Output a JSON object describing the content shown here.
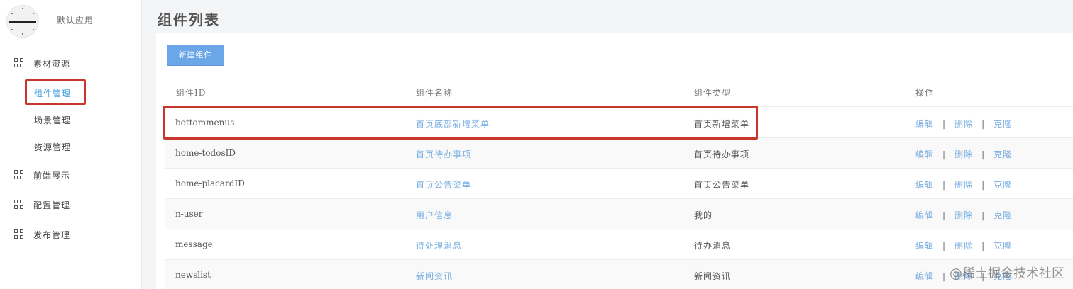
{
  "app": {
    "name": "默认应用"
  },
  "sidebar": {
    "groups": [
      {
        "label": "素材资源",
        "items": [
          "组件管理",
          "场景管理",
          "资源管理"
        ]
      },
      {
        "label": "前端展示"
      },
      {
        "label": "配置管理"
      },
      {
        "label": "发布管理"
      }
    ],
    "active_item": "组件管理"
  },
  "page": {
    "title": "组件列表"
  },
  "toolbar": {
    "new_label": "新建组件"
  },
  "table": {
    "headers": [
      "组件ID",
      "组件名称",
      "组件类型",
      "操作"
    ],
    "rows": [
      {
        "id": "bottommenus",
        "name": "首页底部新增菜单",
        "type": "首页新增菜单"
      },
      {
        "id": "home-todosID",
        "name": "首页待办事项",
        "type": "首页待办事项"
      },
      {
        "id": "home-placardID",
        "name": "首页公告菜单",
        "type": "首页公告菜单"
      },
      {
        "id": "n-user",
        "name": "用户信息",
        "type": "我的"
      },
      {
        "id": "message",
        "name": "待处理消息",
        "type": "待办消息"
      },
      {
        "id": "newslist",
        "name": "新闻资讯",
        "type": "新闻资讯"
      }
    ],
    "actions": {
      "edit": "编辑",
      "delete": "删除",
      "clone": "克隆",
      "separator": "|"
    }
  },
  "watermark": "@稀土掘金技术社区",
  "colors": {
    "accent": "#4aa3e0",
    "link": "#7aaee0",
    "button": "#6aa6e8",
    "highlight": "#c9372c"
  }
}
